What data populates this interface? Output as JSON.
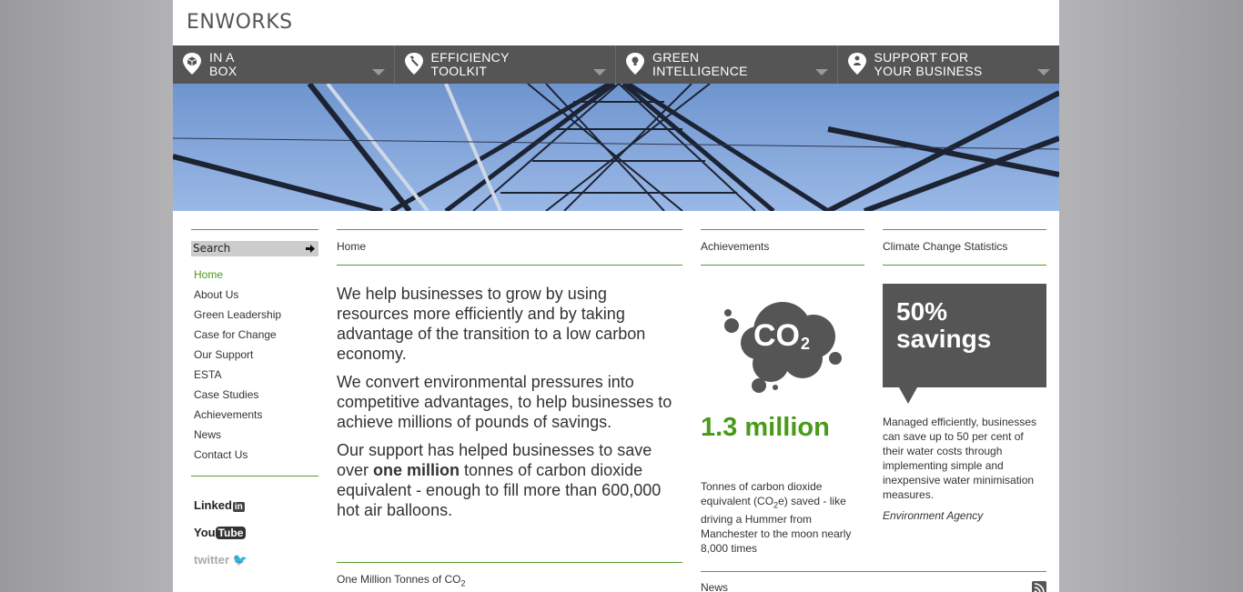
{
  "header": {
    "logo_text": "ENWORKS"
  },
  "nav": {
    "items": [
      {
        "label_line1": "IN A",
        "label_line2": "BOX",
        "icon": "box-icon"
      },
      {
        "label_line1": "EFFICIENCY",
        "label_line2": "TOOLKIT",
        "icon": "wrench-icon"
      },
      {
        "label_line1": "GREEN",
        "label_line2": "INTELLIGENCE",
        "icon": "lightbulb-icon"
      },
      {
        "label_line1": "SUPPORT FOR",
        "label_line2": "YOUR BUSINESS",
        "icon": "person-icon"
      }
    ]
  },
  "sidebar": {
    "search_label": "Search",
    "items": [
      {
        "label": "Home"
      },
      {
        "label": "About Us"
      },
      {
        "label": "Green Leadership"
      },
      {
        "label": "Case for Change"
      },
      {
        "label": "Our Support"
      },
      {
        "label": "ESTA"
      },
      {
        "label": "Case Studies"
      },
      {
        "label": "Achievements"
      },
      {
        "label": "News"
      },
      {
        "label": "Contact Us"
      }
    ],
    "social": {
      "linkedin_text": "Linked",
      "linkedin_in": "in",
      "youtube_you": "You",
      "youtube_tube": "Tube",
      "twitter_text": "twitter"
    }
  },
  "main": {
    "breadcrumb": "Home",
    "para1": "We help businesses to grow by using resources more efficiently and by taking advantage of the transition to a low carbon economy.",
    "para2": "We convert environmental pressures into competitive advantages, to help businesses to achieve millions of pounds of savings.",
    "para3_before": "Our support has helped businesses to save over ",
    "para3_bold": "one million",
    "para3_after": " tonnes of carbon dioxide equivalent - enough to fill more than 600,000 hot air balloons.",
    "section2_title": "One Million Tonnes of CO",
    "section2_sub": "2"
  },
  "achievements": {
    "title": "Achievements",
    "co2_text": "CO",
    "co2_sub": "2",
    "big_number": "1.3 million",
    "text_before": "Tonnes of carbon dioxide equivalent (CO",
    "text_sub": "2",
    "text_after": "e) saved - like driving a Hummer from Manchester to the moon nearly 8,000 times"
  },
  "climate": {
    "title": "Climate Change Statistics",
    "stat_line1": "50%",
    "stat_line2": "savings",
    "text": "Managed efficiently, businesses can save up to 50 per cent of their water costs through implementing simple and inexpensive water minimisation measures.",
    "source": "Environment Agency"
  },
  "news": {
    "title": "News",
    "icon": "rss-icon"
  },
  "colors": {
    "accent_green": "#4a9a1a",
    "nav_bg": "#555555",
    "stat_box": "#555555"
  }
}
